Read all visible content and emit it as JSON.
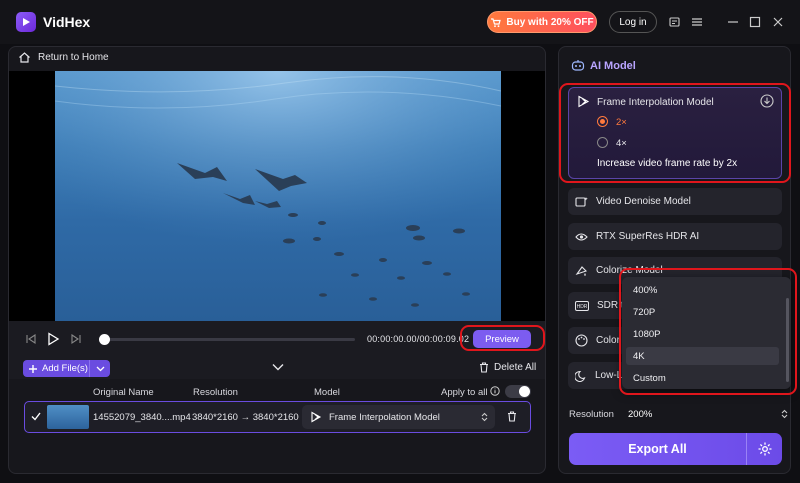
{
  "app": {
    "name": "VidHex"
  },
  "titlebar": {
    "buy_label": "Buy with 20% OFF",
    "login_label": "Log in"
  },
  "nav": {
    "home_label": "Return to Home"
  },
  "player": {
    "timecode": "00:00:00.00/00:00:09.02",
    "preview_label": "Preview"
  },
  "filebar": {
    "add_label": "Add File(s)",
    "delete_all_label": "Delete All"
  },
  "table": {
    "headers": {
      "name": "Original Name",
      "resolution": "Resolution",
      "model": "Model",
      "apply_all": "Apply to all"
    },
    "apply_all_on": false,
    "rows": [
      {
        "name": "14552079_3840....mp4",
        "resolution": "3840*2160 → 3840*2160",
        "model": "Frame Interpolation Model",
        "checked": true
      }
    ]
  },
  "ai_panel": {
    "title": "AI Model",
    "frame_interpolation": {
      "title": "Frame Interpolation Model",
      "options": [
        "2×",
        "4×"
      ],
      "selected": "2×",
      "description": "Increase video frame rate by 2x"
    },
    "models": [
      "Video Denoise Model",
      "RTX SuperRes HDR AI",
      "Colorize Model",
      "SDR to",
      "Color",
      "Low-L"
    ]
  },
  "resolution": {
    "label": "Resolution",
    "value": "200%"
  },
  "dropdown": {
    "options": [
      "400%",
      "720P",
      "1080P",
      "4K",
      "Custom"
    ],
    "highlighted": "4K"
  },
  "export": {
    "label": "Export All"
  },
  "colors": {
    "accent": "#7c5cf0",
    "promo": "#ff5a4e",
    "highlight_box": "#e0161c",
    "radio_on": "#ff7a3d"
  }
}
